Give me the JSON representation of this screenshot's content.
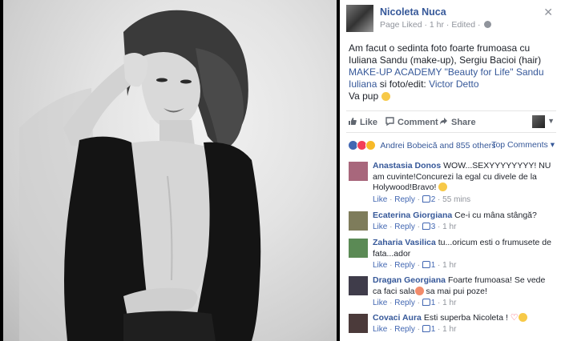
{
  "post": {
    "author": "Nicoleta Nuca",
    "meta_prefix": "Page Liked",
    "time": "1 hr",
    "edited": "Edited",
    "text_part1": "Am facut o sedinta foto foarte frumoasa cu Iuliana Sandu (make-up), Sergiu Bacioi (hair) ",
    "text_link1": "MAKE-UP ACADEMY \"Beauty for Life\" Sandu Iuliana",
    "text_part2": " si foto/edit: ",
    "text_link2": "Victor Detto",
    "text_line2": "Va pup"
  },
  "actions": {
    "like": "Like",
    "comment": "Comment",
    "share": "Share"
  },
  "reactions": {
    "summary": "Andrei Bobeică and 855 others",
    "sort": "Top Comments"
  },
  "comments": [
    {
      "name": "Anastasia Donos",
      "text": "WOW...SEXYYYYYYYY! NU am cuvinte!Concurezi la egal cu divele de la Holywood!Bravo!",
      "like": "Like",
      "reply": "Reply",
      "likes": "2",
      "time": "55 mins",
      "avatar_color": "#a8677c"
    },
    {
      "name": "Ecaterina Giorgiana",
      "text": "Ce-i cu mâna stângă?",
      "like": "Like",
      "reply": "Reply",
      "likes": "3",
      "time": "1 hr",
      "avatar_color": "#7e7c5b"
    },
    {
      "name": "Zaharia Vasilica",
      "text": "tu...oricum esti o frumusete de fata...ador",
      "like": "Like",
      "reply": "Reply",
      "likes": "1",
      "time": "1 hr",
      "avatar_color": "#5b8a55"
    },
    {
      "name": "Dragan Georgiana",
      "text_before": "Foarte frumoasa! Se vede ca faci sala",
      "text_after": " sa mai pui poze!",
      "like": "Like",
      "reply": "Reply",
      "likes": "1",
      "time": "1 hr",
      "avatar_color": "#3f3c4a"
    },
    {
      "name": "Covaci Aura",
      "text": "Esti superba Nicoleta !",
      "like": "Like",
      "reply": "Reply",
      "likes": "1",
      "time": "1 hr",
      "avatar_color": "#4b3a3a"
    }
  ]
}
